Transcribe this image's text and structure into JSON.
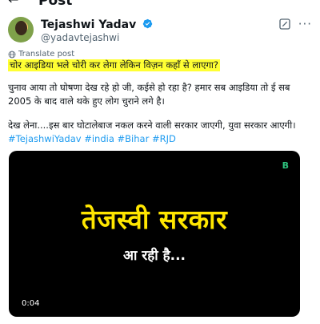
{
  "header": {
    "back_icon": "arrow-left-icon",
    "back_glyph": "←",
    "title": "Post"
  },
  "author": {
    "name": "Tejashwi Yadav",
    "handle": "@yadavtejashwi",
    "verified": true,
    "more_glyph": "···"
  },
  "translate": {
    "label": "Translate post"
  },
  "tweet": {
    "highlight_line": "चोर आइडिया भले चोरी कर लेगा लेकिन विज़न कहाँ से लाएगा?",
    "line1": "चुनाव आया तो घोषणा देख रहे हो जी, कईसे हो रहा है? हमार सब आइडिया तो ई  सब",
    "line2": "2005 के बाद वाले थके हुए लोग चुराने लगे है।",
    "line3": "देख लेना....इस बार घोटालेबाज नकल करने वाली सरकार जाएगी, युवा सरकार आएगी।",
    "hashtags": [
      "#TejashwiYadav",
      "#india",
      "#Bihar",
      "#RJD"
    ]
  },
  "media": {
    "logo": "B",
    "headline": "तेजस्वी सरकार",
    "subline": "आ रही है...",
    "duration": "0:04"
  },
  "colors": {
    "link": "#1d9bf0",
    "highlight": "#ffff33",
    "video_headline": "#ffe600",
    "video_logo": "#2ec27e"
  }
}
